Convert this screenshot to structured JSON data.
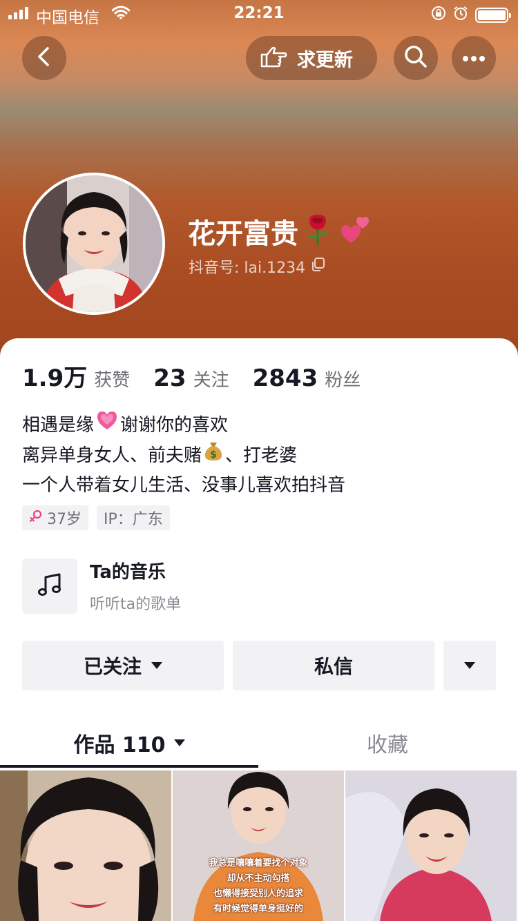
{
  "status_bar": {
    "carrier": "中国电信",
    "time": "22:21"
  },
  "header": {
    "update_label": "求更新",
    "nickname": "花开富贵",
    "nickname_emojis": [
      "rose-emoji",
      "two-hearts-emoji"
    ],
    "douyin_id": "抖音号: lai.1234"
  },
  "stats": [
    {
      "num": "1.9万",
      "label": "获赞"
    },
    {
      "num": "23",
      "label": "关注"
    },
    {
      "num": "2843",
      "label": "粉丝"
    }
  ],
  "bio": {
    "line1_a": "相遇是缘",
    "line1_b": "谢谢你的喜欢",
    "line2_a": "离异单身女人、前夫赌",
    "line2_b": "、打老婆",
    "line3": "一个人带着女儿生活、没事儿喜欢拍抖音"
  },
  "tags": {
    "age": "37岁",
    "ip": "IP：广东"
  },
  "music": {
    "title": "Ta的音乐",
    "subtitle": "听听ta的歌单"
  },
  "actions": {
    "follow": "已关注",
    "message": "私信"
  },
  "tabs": {
    "works": "作品 110",
    "favorites": "收藏"
  },
  "thumbnails": {
    "caption_lines": [
      "我总是嚷嚷着要找个对象",
      "却从不主动勾搭",
      "也懒得接受别人的追求",
      "有时候觉得单身挺好的"
    ]
  },
  "colors": {
    "accent_pink": "#e8467c",
    "text_primary": "#161823",
    "text_secondary": "#6f7075",
    "chip_bg": "#f2f2f4"
  }
}
